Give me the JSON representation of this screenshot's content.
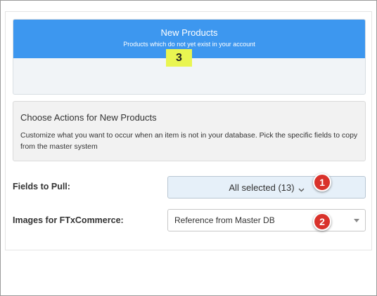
{
  "new_products": {
    "title": "New Products",
    "subtitle": "Products which do not yet exist in your account",
    "count": "3",
    "header_color": "#3d97ef",
    "highlight_color": "#e9f551"
  },
  "actions": {
    "title": "Choose Actions for New Products",
    "description": "Customize what you want to occur when an item is not in your database. Pick the specific fields to copy from the master system"
  },
  "fields_to_pull": {
    "label": "Fields to Pull:",
    "value": "All selected (13)",
    "icon": "chevron-down-icon"
  },
  "images": {
    "label": "Images for FTxCommerce:",
    "value": "Reference from Master DB",
    "icon": "caret-down-icon"
  },
  "callouts": [
    "1",
    "2"
  ],
  "callout_color": "#d9322b"
}
